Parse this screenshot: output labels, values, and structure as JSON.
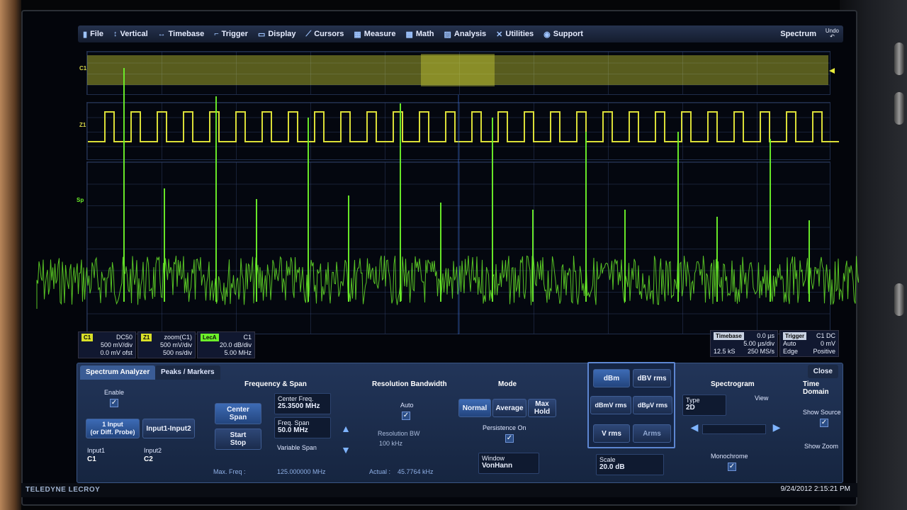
{
  "menu": {
    "items": [
      {
        "label": "File",
        "icon": "file-icon",
        "glyph": "▮"
      },
      {
        "label": "Vertical",
        "icon": "vertical-icon",
        "glyph": "↕"
      },
      {
        "label": "Timebase",
        "icon": "timebase-icon",
        "glyph": "↔"
      },
      {
        "label": "Trigger",
        "icon": "trigger-icon",
        "glyph": "⌐"
      },
      {
        "label": "Display",
        "icon": "display-icon",
        "glyph": "▭"
      },
      {
        "label": "Cursors",
        "icon": "cursors-icon",
        "glyph": "⟋"
      },
      {
        "label": "Measure",
        "icon": "measure-icon",
        "glyph": "▦"
      },
      {
        "label": "Math",
        "icon": "math-icon",
        "glyph": "▩"
      },
      {
        "label": "Analysis",
        "icon": "analysis-icon",
        "glyph": "▨"
      },
      {
        "label": "Utilities",
        "icon": "utilities-icon",
        "glyph": "✕"
      },
      {
        "label": "Support",
        "icon": "support-icon",
        "glyph": "◉"
      }
    ],
    "mode_title": "Spectrum",
    "undo_label": "Undo"
  },
  "traces": {
    "top_label": "C1",
    "mid_label": "Z1",
    "spec_label": "Sp"
  },
  "descriptors": {
    "c1": {
      "badge": "C1",
      "coupling": "DC50",
      "vdiv": "500 mV/div",
      "offset": "0.0 mV ofst"
    },
    "zoom": {
      "badge": "Z1",
      "title": "zoom(C1)",
      "vdiv": "500 mV/div",
      "tdiv": "500 ns/div"
    },
    "fft": {
      "badge": "LecA",
      "title": "C1",
      "ydiv": "20.0 dB/div",
      "xdiv": "5.00 MHz"
    },
    "timebase": {
      "title": "Timebase",
      "delay": "0.0 µs",
      "tdiv": "5.00 µs/div",
      "samples": "12.5 kS",
      "rate": "250 MS/s"
    },
    "trigger": {
      "title": "Trigger",
      "channel": "C1 DC",
      "mode": "Auto",
      "level": "0 mV",
      "type": "Edge",
      "slope": "Positive"
    }
  },
  "dialog": {
    "tabs": [
      "Spectrum Analyzer",
      "Peaks / Markers"
    ],
    "close_label": "Close",
    "input": {
      "enable_label": "Enable",
      "enable_checked": true,
      "one_input": "1 Input\n(or Diff. Probe)",
      "input_diff": "Input1-Input2",
      "input1_label": "Input1",
      "input1_value": "C1",
      "input2_label": "Input2",
      "input2_value": "C2"
    },
    "freq_span": {
      "title": "Frequency & Span",
      "center_span": "Center\nSpan",
      "start_stop": "Start\nStop",
      "center_label": "Center Freq.",
      "center_value": "25.3500 MHz",
      "span_label": "Freq. Span",
      "span_value": "50.0 MHz",
      "variable_span": "Variable Span",
      "max_freq_label": "Max. Freq :",
      "max_freq_value": "125.000000 MHz"
    },
    "rbw": {
      "title": "Resolution Bandwidth",
      "auto_label": "Auto",
      "auto_checked": true,
      "rbw_label": "Resolution BW",
      "rbw_value": "100 kHz",
      "actual_label": "Actual :",
      "actual_value": "45.7764 kHz"
    },
    "mode": {
      "title": "Mode",
      "normal": "Normal",
      "average": "Average",
      "max_hold": "Max\nHold",
      "persistence_label": "Persistence On",
      "persistence_checked": true,
      "window_label": "Window",
      "window_value": "VonHann"
    },
    "units": {
      "dbm": "dBm",
      "dbv_rms": "dBV rms",
      "dbmv_rms": "dBmV rms",
      "dbuv_rms": "dBµV rms",
      "v_rms": "V rms",
      "a_rms": "Arms",
      "scale_label": "Scale",
      "scale_value": "20.0 dB"
    },
    "spectrogram": {
      "title": "Spectrogram",
      "type_label": "Type",
      "type_value": "2D",
      "view_label": "View",
      "monochrome_label": "Monochrome",
      "monochrome_checked": true
    },
    "time_domain": {
      "title": "Time Domain",
      "show_source_label": "Show Source",
      "show_source_checked": true,
      "show_zoom_label": "Show Zoom"
    }
  },
  "status": {
    "brand": "TELEDYNE LECROY",
    "datetime": "9/24/2012 2:15:21 PM"
  },
  "colors": {
    "trace_yellow": "#e6ea3a",
    "spectrum_green": "#6df22a",
    "accent_blue": "#3d6bb5"
  }
}
